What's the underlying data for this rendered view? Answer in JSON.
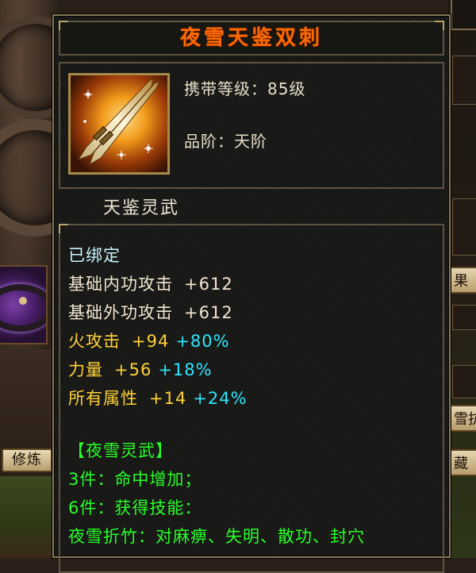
{
  "item": {
    "name": "夜雪天鉴双刺",
    "level_label": "携带等级：85级",
    "grade_label": "品阶：天阶",
    "subtitle": "天鉴灵武"
  },
  "stats": {
    "bound": "已绑定",
    "base_lines": [
      {
        "label": "基础内功攻击",
        "value": "+612"
      },
      {
        "label": "基础外功攻击",
        "value": "+612"
      }
    ],
    "bonus_lines": [
      {
        "label": "火攻击",
        "value": "+94",
        "pct": "+80%"
      },
      {
        "label": "力量",
        "value": "+56",
        "pct": "+18%"
      },
      {
        "label": "所有属性",
        "value": "+14",
        "pct": "+24%"
      }
    ]
  },
  "set": {
    "name": "【夜雪灵武】",
    "lines": [
      "3件：命中增加；",
      "6件：获得技能：",
      "夜雪折竹：对麻痹、失明、散功、封穴"
    ]
  },
  "background": {
    "train_button": "修炼",
    "right_buttons": [
      "果",
      "雪抗",
      "藏"
    ]
  },
  "colors": {
    "title": "#ff6a00",
    "bound": "#c8f4ff",
    "base": "#f2e6d0",
    "bonus_label": "#ffd23a",
    "bonus_pct": "#2ee6ff",
    "set": "#28ff28"
  },
  "icons": {
    "item_icon": "twin-daggers-icon",
    "bracelet_icon": "bracelet-icon"
  }
}
